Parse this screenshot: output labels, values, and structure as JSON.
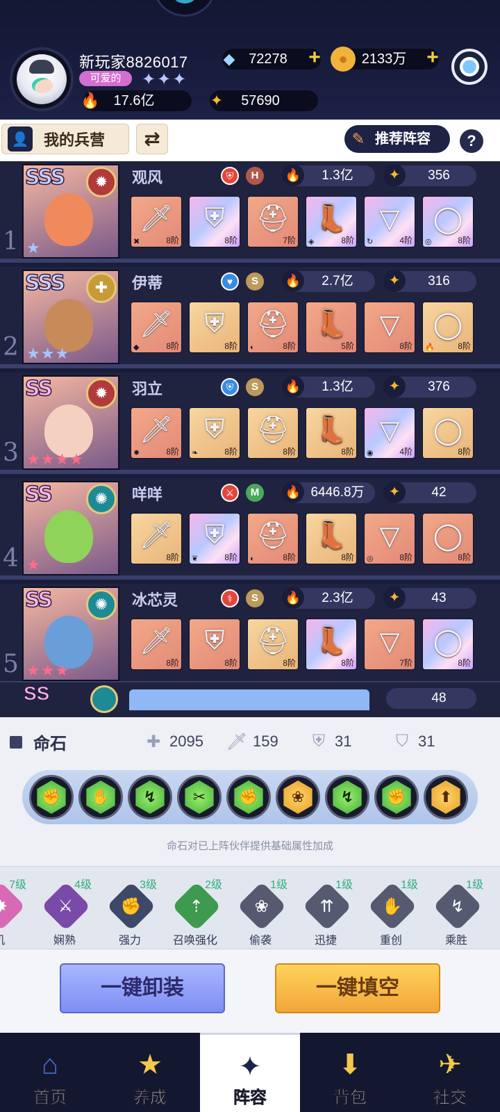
{
  "colors": {
    "panel_dark": "#20233f",
    "row_divider": "#3a3f6c",
    "accent_gold": "#f4d13a",
    "level_green": "#2fae7e",
    "button_purple": "#7d8ef3",
    "button_orange": "#f2a63a"
  },
  "player": {
    "name": "新玩家8826017",
    "title": "可爱的",
    "title_stars": "✦✦✦",
    "power": "17.6亿",
    "level_points": "57690"
  },
  "currency": {
    "diamonds": "72278",
    "gold": "2133万",
    "plus": "+"
  },
  "toolbar": {
    "barracks_label": "我的兵营",
    "swap_icon": "⇄",
    "recommend_label": "推荐阵容",
    "help_label": "?"
  },
  "heroes": [
    {
      "index": "1",
      "rank": "SSS",
      "rank_color": "#c9d2ff",
      "element": "fire",
      "element_color": "#b23a3a",
      "element_glyph": "✹",
      "stars": "★",
      "star_color": "#a8c4ff",
      "name": "观风",
      "class_glyph": "⛨",
      "class_color": "#e3463a",
      "grade": "H",
      "grade_color": "#b0584a",
      "power": "1.3亿",
      "level": "356",
      "face": "#f08a5c",
      "gear": [
        {
          "icon": "sword-icon",
          "glyph": "🗡",
          "tier": "8阶",
          "sub": "✖",
          "style": "orange"
        },
        {
          "icon": "armor-icon",
          "glyph": "⛨",
          "tier": "8阶",
          "sub": "",
          "style": "holo"
        },
        {
          "icon": "helmet-icon",
          "glyph": "⛑",
          "tier": "7阶",
          "sub": "",
          "style": "orange"
        },
        {
          "icon": "boots-icon",
          "glyph": "👢",
          "tier": "8阶",
          "sub": "◈",
          "style": "holo"
        },
        {
          "icon": "necklace-icon",
          "glyph": "▽",
          "tier": "4阶",
          "sub": "↻",
          "style": "holo"
        },
        {
          "icon": "ring-icon",
          "glyph": "◯",
          "tier": "8阶",
          "sub": "◎",
          "style": "holo"
        }
      ]
    },
    {
      "index": "2",
      "rank": "SSS",
      "rank_color": "#c9d2ff",
      "element": "light",
      "element_color": "#c79a3a",
      "element_glyph": "✚",
      "stars": "★★★",
      "star_color": "#a8c4ff",
      "name": "伊蒂",
      "class_glyph": "♥",
      "class_color": "#3a8be3",
      "grade": "S",
      "grade_color": "#bb9a5a",
      "power": "2.7亿",
      "level": "316",
      "face": "#c98a5a",
      "gear": [
        {
          "icon": "sword-icon",
          "glyph": "🗡",
          "tier": "8阶",
          "sub": "◆",
          "style": "orange"
        },
        {
          "icon": "armor-icon",
          "glyph": "⛨",
          "tier": "8阶",
          "sub": "",
          "style": "gold"
        },
        {
          "icon": "helmet-icon",
          "glyph": "⛑",
          "tier": "8阶",
          "sub": "◐",
          "style": "orange"
        },
        {
          "icon": "boots-icon",
          "glyph": "👢",
          "tier": "5阶",
          "sub": "",
          "style": "orange"
        },
        {
          "icon": "necklace-icon",
          "glyph": "▽",
          "tier": "8阶",
          "sub": "",
          "style": "orange"
        },
        {
          "icon": "ring-icon",
          "glyph": "◯",
          "tier": "8阶",
          "sub": "🔥",
          "style": "gold"
        }
      ]
    },
    {
      "index": "3",
      "rank": "SS",
      "rank_color": "#ffb5e8",
      "element": "fire",
      "element_color": "#b23a3a",
      "element_glyph": "✹",
      "stars": "★★★★",
      "star_color": "#ff6b8a",
      "name": "羽立",
      "class_glyph": "⛨",
      "class_color": "#3a8be3",
      "grade": "S",
      "grade_color": "#bb9a5a",
      "power": "1.3亿",
      "level": "376",
      "face": "#f4d0c0",
      "gear": [
        {
          "icon": "sword-icon",
          "glyph": "🗡",
          "tier": "8阶",
          "sub": "✸",
          "style": "orange"
        },
        {
          "icon": "armor-icon",
          "glyph": "⛨",
          "tier": "8阶",
          "sub": "❧",
          "style": "gold"
        },
        {
          "icon": "helmet-icon",
          "glyph": "⛑",
          "tier": "8阶",
          "sub": "",
          "style": "gold"
        },
        {
          "icon": "boots-icon",
          "glyph": "👢",
          "tier": "8阶",
          "sub": "",
          "style": "gold"
        },
        {
          "icon": "necklace-icon",
          "glyph": "▽",
          "tier": "4阶",
          "sub": "◉",
          "style": "holo"
        },
        {
          "icon": "ring-icon",
          "glyph": "◯",
          "tier": "8阶",
          "sub": "",
          "style": "gold"
        }
      ]
    },
    {
      "index": "4",
      "rank": "SS",
      "rank_color": "#ffb5e8",
      "element": "wind",
      "element_color": "#1e8a96",
      "element_glyph": "✺",
      "stars": "★",
      "star_color": "#ff6b8a",
      "name": "咩咩",
      "class_glyph": "⚔",
      "class_color": "#e3463a",
      "grade": "M",
      "grade_color": "#4aa85a",
      "power": "6446.8万",
      "level": "42",
      "face": "#8fd35a",
      "gear": [
        {
          "icon": "sword-icon",
          "glyph": "🗡",
          "tier": "8阶",
          "sub": "",
          "style": "gold"
        },
        {
          "icon": "armor-icon",
          "glyph": "⛨",
          "tier": "8阶",
          "sub": "❦",
          "style": "holo"
        },
        {
          "icon": "helmet-icon",
          "glyph": "⛑",
          "tier": "8阶",
          "sub": "◐",
          "style": "orange"
        },
        {
          "icon": "boots-icon",
          "glyph": "👢",
          "tier": "8阶",
          "sub": "",
          "style": "gold"
        },
        {
          "icon": "necklace-icon",
          "glyph": "▽",
          "tier": "8阶",
          "sub": "◎",
          "style": "orange"
        },
        {
          "icon": "ring-icon",
          "glyph": "◯",
          "tier": "8阶",
          "sub": "",
          "style": "orange"
        }
      ]
    },
    {
      "index": "5",
      "rank": "SS",
      "rank_color": "#ffb5e8",
      "element": "wind",
      "element_color": "#1e8a96",
      "element_glyph": "✺",
      "stars": "★★★",
      "star_color": "#ff6b8a",
      "name": "冰芯灵",
      "class_glyph": "⚕",
      "class_color": "#e3463a",
      "grade": "S",
      "grade_color": "#bb9a5a",
      "power": "2.3亿",
      "level": "43",
      "face": "#6a9ed8",
      "gear": [
        {
          "icon": "sword-icon",
          "glyph": "🗡",
          "tier": "8阶",
          "sub": "",
          "style": "orange"
        },
        {
          "icon": "armor-icon",
          "glyph": "⛨",
          "tier": "8阶",
          "sub": "",
          "style": "orange"
        },
        {
          "icon": "helmet-icon",
          "glyph": "⛑",
          "tier": "8阶",
          "sub": "",
          "style": "gold"
        },
        {
          "icon": "boots-icon",
          "glyph": "👢",
          "tier": "8阶",
          "sub": "",
          "style": "holo"
        },
        {
          "icon": "necklace-icon",
          "glyph": "▽",
          "tier": "7阶",
          "sub": "",
          "style": "orange"
        },
        {
          "icon": "ring-icon",
          "glyph": "◯",
          "tier": "8阶",
          "sub": "",
          "style": "holo"
        }
      ]
    }
  ],
  "partial_hero": {
    "rank": "SS",
    "level": "48"
  },
  "life_stone": {
    "title": "命石",
    "hp": "2095",
    "attack": "159",
    "defense": "31",
    "resist": "31",
    "hint": "命石对已上阵伙伴提供基础属性加成",
    "stones": [
      {
        "icon": "fist-stone-icon",
        "glyph": "✊",
        "style": "green"
      },
      {
        "icon": "claw-stone-icon",
        "glyph": "✋",
        "style": "green"
      },
      {
        "icon": "swift-stone-icon",
        "glyph": "↯",
        "style": "green"
      },
      {
        "icon": "slash-stone-icon",
        "glyph": "✂",
        "style": "green"
      },
      {
        "icon": "fist-stone-icon",
        "glyph": "✊",
        "style": "green"
      },
      {
        "icon": "paw-stone-icon",
        "glyph": "❀",
        "style": "gold"
      },
      {
        "icon": "swift-stone-icon",
        "glyph": "↯",
        "style": "green"
      },
      {
        "icon": "fist-stone-icon",
        "glyph": "✊",
        "style": "green"
      },
      {
        "icon": "agility-stone-icon",
        "glyph": "⬆",
        "style": "gold"
      }
    ]
  },
  "effects": [
    {
      "label": "机",
      "level": "7级",
      "color": "#d86ab5",
      "glyph": "✸"
    },
    {
      "label": "娴熟",
      "level": "4级",
      "color": "#7a4aa8",
      "glyph": "⚔"
    },
    {
      "label": "强力",
      "level": "3级",
      "color": "#3e4868",
      "glyph": "✊"
    },
    {
      "label": "召唤强化",
      "level": "2级",
      "color": "#3d9a4e",
      "glyph": "⇡"
    },
    {
      "label": "偷袭",
      "level": "1级",
      "color": "#555a70",
      "glyph": "❀"
    },
    {
      "label": "迅捷",
      "level": "1级",
      "color": "#555a70",
      "glyph": "⇈"
    },
    {
      "label": "重创",
      "level": "1级",
      "color": "#555a70",
      "glyph": "✋"
    },
    {
      "label": "乘胜",
      "level": "1级",
      "color": "#555a70",
      "glyph": "↯"
    }
  ],
  "actions": {
    "unequip_all": "一键卸装",
    "fill_all": "一键填空"
  },
  "nav": [
    {
      "label": "首页",
      "icon": "home-icon",
      "glyph": "⌂",
      "color": "#4a6cd6"
    },
    {
      "label": "养成",
      "icon": "star-icon",
      "glyph": "★",
      "color": "#f2c94a"
    },
    {
      "label": "阵容",
      "icon": "formation-icon",
      "glyph": "✦",
      "color": "#1d2248"
    },
    {
      "label": "背包",
      "icon": "bag-icon",
      "glyph": "⬇",
      "color": "#f2c94a"
    },
    {
      "label": "社交",
      "icon": "social-icon",
      "glyph": "✈",
      "color": "#f2c94a"
    }
  ]
}
